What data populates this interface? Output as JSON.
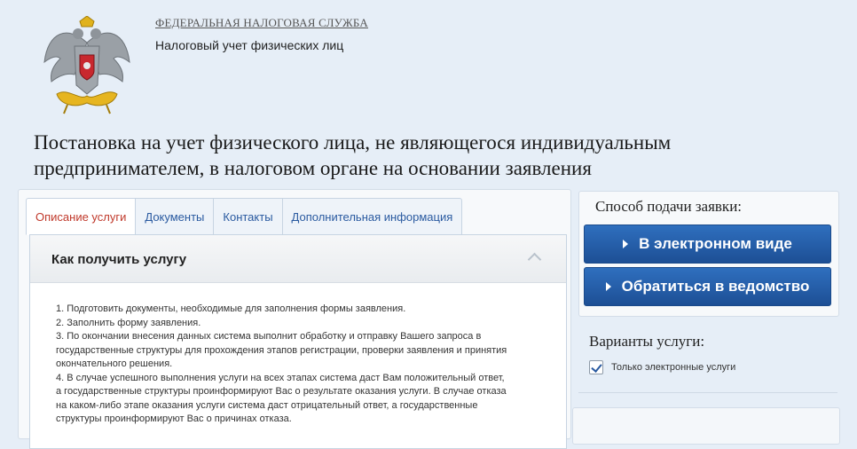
{
  "header": {
    "org_name": "ФЕДЕРАЛЬНАЯ НАЛОГОВАЯ СЛУЖБА",
    "org_subtitle": "Налоговый учет физических лиц",
    "emblem_icon": "double-headed-eagle-emblem"
  },
  "page_title": "Постановка на учет физического лица, не являющегося индивидуальным предпринимателем, в налоговом органе на основании заявления",
  "tabs": [
    {
      "label": "Описание услуги",
      "active": true
    },
    {
      "label": "Документы",
      "active": false
    },
    {
      "label": "Контакты",
      "active": false
    },
    {
      "label": "Дополнительная информация",
      "active": false
    }
  ],
  "accordion": {
    "title": "Как получить услугу",
    "steps": [
      "1. Подготовить документы, необходимые для заполнения формы заявления.",
      "2. Заполнить форму заявления.",
      "3. По окончании внесения данных система выполнит обработку и отправку Вашего запроса в государственные структуры для прохождения этапов регистрации, проверки заявления и принятия окончательного решения.",
      "4. В случае успешного выполнения услуги на всех этапах система даст Вам положительный ответ, а государственные структуры проинформируют Вас о результате оказания услуги. В случае отказа на каком-либо этапе оказания услуги система даст отрицательный ответ, а государственные структуры проинформируют Вас о причинах отказа."
    ]
  },
  "sidebar": {
    "submission_title": "Способ подачи заявки:",
    "btn_electronic": "В электронном виде",
    "btn_agency": "Обратиться в ведомство",
    "variants_title": "Варианты услуги:",
    "checkbox_label": "Только электронные услуги",
    "checkbox_checked": true
  },
  "colors": {
    "accent_blue": "#1d4f95",
    "active_tab": "#c0392b",
    "link": "#2a5aa0"
  }
}
